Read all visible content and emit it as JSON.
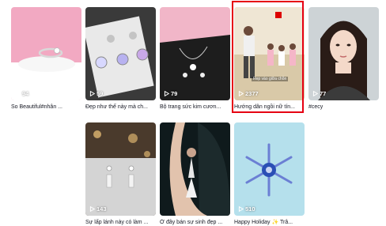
{
  "videos_row1": [
    {
      "views": "94",
      "caption": "So Beautiful#nhẫn ...",
      "thumb_icon": "ring-icon"
    },
    {
      "views": "59",
      "caption": "Đẹp như thế này mà ch...",
      "thumb_icon": "earrings-icon"
    },
    {
      "views": "79",
      "caption": "Bộ trang sức kim cươn...",
      "thumb_icon": "necklace-icon"
    },
    {
      "views": "2377",
      "caption": "Hướng dẫn ngồi nữ tín...",
      "overlay": "Rep vào giữa chỗn",
      "thumb_icon": "people-icon"
    },
    {
      "views": "77",
      "caption": "#cecy",
      "thumb_icon": "portrait-icon"
    }
  ],
  "videos_row2": [
    {
      "views": "143",
      "caption": "Sự lấp lánh này có làm ...",
      "thumb_icon": "earrings-icon"
    },
    {
      "views": "",
      "caption": "Ở đây bán sự sinh đẹp ...",
      "thumb_icon": "portrait-icon"
    },
    {
      "views": "510",
      "caption": "Happy Holiday ✨ Trâ...",
      "thumb_icon": "snowflake-icon"
    }
  ],
  "colors": {
    "selected_border": "#e60012",
    "text": "#161823"
  }
}
